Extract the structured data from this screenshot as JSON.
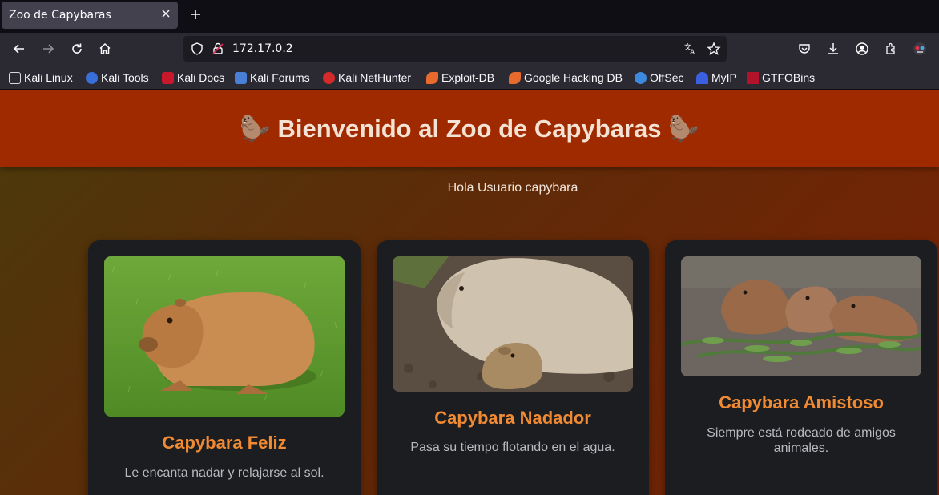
{
  "browser": {
    "tab_title": "Zoo de Capybaras",
    "url": "172.17.0.2",
    "bookmarks": [
      {
        "label": "Kali Linux",
        "icon": "kali-dragon-icon",
        "color": "#d9d9d9"
      },
      {
        "label": "Kali Tools",
        "icon": "kali-tools-icon",
        "color": "#3b6fd8"
      },
      {
        "label": "Kali Docs",
        "icon": "kali-docs-icon",
        "color": "#c7192b"
      },
      {
        "label": "Kali Forums",
        "icon": "kali-forums-icon",
        "color": "#4a7fd6"
      },
      {
        "label": "Kali NetHunter",
        "icon": "nethunter-icon",
        "color": "#d42a2a"
      },
      {
        "label": "Exploit-DB",
        "icon": "exploit-db-icon",
        "color": "#e86a2c"
      },
      {
        "label": "Google Hacking DB",
        "icon": "ghdb-icon",
        "color": "#e86a2c"
      },
      {
        "label": "OffSec",
        "icon": "offsec-icon",
        "color": "#3b8ae0"
      },
      {
        "label": "MyIP",
        "icon": "myip-icon",
        "color": "#3a5fe0"
      },
      {
        "label": "GTFOBins",
        "icon": "gtfobins-icon",
        "color": "#b3122b"
      }
    ]
  },
  "site": {
    "title": "🦫 Bienvenido al Zoo de Capybaras 🦫",
    "greeting": "Hola Usuario capybara",
    "accent_color": "#f08a33",
    "header_color": "#a02a00",
    "cards": [
      {
        "title": "Capybara Feliz",
        "description": "Le encanta nadar y relajarse al sol."
      },
      {
        "title": "Capybara Nadador",
        "description": "Pasa su tiempo flotando en el agua."
      },
      {
        "title": "Capybara Amistoso",
        "description": "Siempre está rodeado de amigos animales."
      }
    ]
  }
}
